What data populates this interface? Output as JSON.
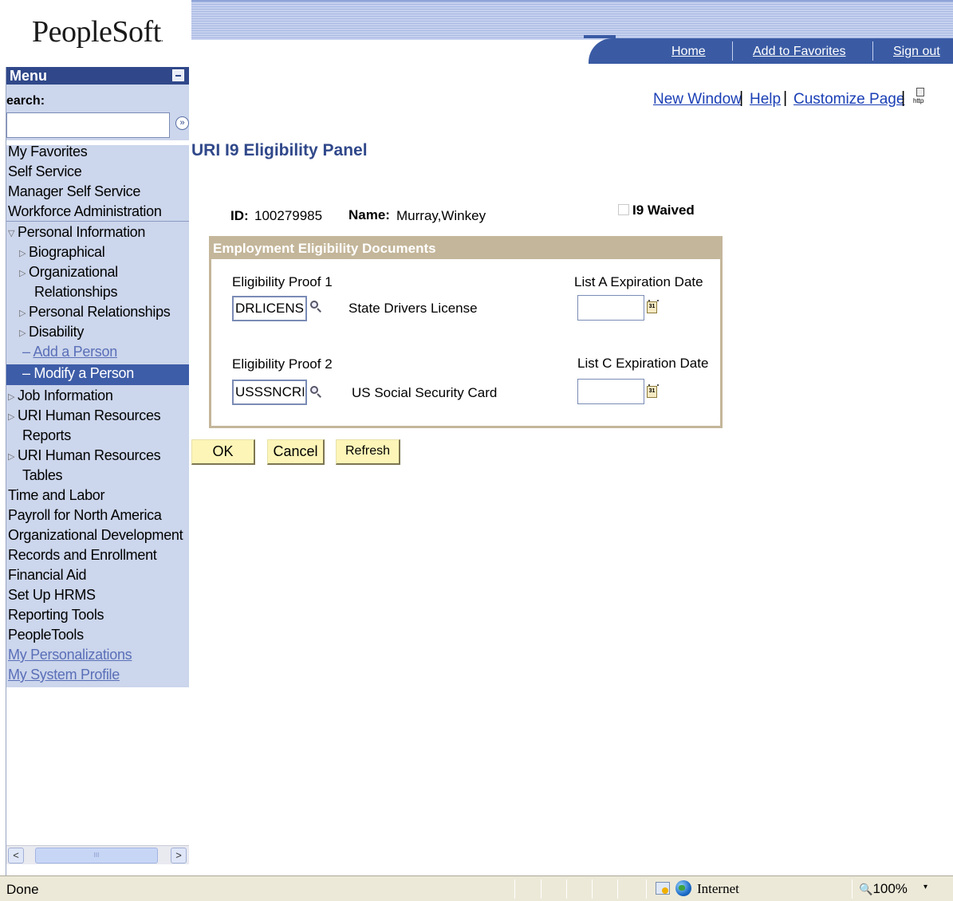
{
  "brand": {
    "logo_text": "PeopleSoft",
    "logo_mark": "."
  },
  "top_nav": {
    "home": "Home",
    "add_to_favorites": "Add to Favorites",
    "sign_out": "Sign out"
  },
  "utility_links": {
    "new_window": "New Window",
    "help": "Help",
    "customize_page": "Customize Page",
    "separator": "|",
    "http_icon_text": "http"
  },
  "menu": {
    "title": "Menu",
    "search_label": "earch:",
    "search_value": "",
    "search_go": "»",
    "items": [
      {
        "label": "My Favorites"
      },
      {
        "label": "Self Service"
      },
      {
        "label": "Manager Self Service"
      },
      {
        "label": "Workforce Administration"
      },
      {
        "label": "Personal Information",
        "marker": "▽"
      },
      {
        "label": "Biographical",
        "marker": "▷"
      },
      {
        "label": "Organizational",
        "marker": "▷"
      },
      {
        "label": "Relationships"
      },
      {
        "label": "Personal Relationships",
        "marker": "▷"
      },
      {
        "label": "Disability",
        "marker": "▷"
      },
      {
        "label": "Add a Person",
        "marker": "–"
      },
      {
        "label": "Modify a Person",
        "marker": "–"
      },
      {
        "label": "Job Information",
        "marker": "▷"
      },
      {
        "label": "URI Human Resources",
        "marker": "▷"
      },
      {
        "label": "Reports"
      },
      {
        "label": "URI Human Resources",
        "marker": "▷"
      },
      {
        "label": "Tables"
      },
      {
        "label": "Time and Labor"
      },
      {
        "label": "Payroll for North America"
      },
      {
        "label": "Organizational Development"
      },
      {
        "label": "Records and Enrollment"
      },
      {
        "label": "Financial Aid"
      },
      {
        "label": "Set Up HRMS"
      },
      {
        "label": "Reporting Tools"
      },
      {
        "label": "PeopleTools"
      },
      {
        "label": "My Personalizations"
      },
      {
        "label": "My System Profile"
      }
    ]
  },
  "scrollbar": {
    "left_arrow": "<",
    "right_arrow": ">",
    "thumb_grip": "III"
  },
  "page": {
    "title": "URI I9 Eligibility Panel",
    "id_label": "ID:",
    "id_value": "100279985",
    "name_label": "Name:",
    "name_value": "Murray,Winkey",
    "i9_waived_label": "I9 Waived",
    "i9_waived_checked": false,
    "group_title": "Employment Eligibility Documents",
    "proof1": {
      "label": "Eligibility Proof 1",
      "code": "DRLICENSI",
      "description": "State Drivers License",
      "exp_label": "List A Expiration Date",
      "exp_value": ""
    },
    "proof2": {
      "label": "Eligibility Proof 2",
      "code": "USSSNCRI",
      "description": "US Social Security Card",
      "exp_label": "List C Expiration Date",
      "exp_value": ""
    },
    "calendar_icon_text": "31",
    "buttons": {
      "ok": "OK",
      "cancel": "Cancel",
      "refresh": "Refresh"
    }
  },
  "status_bar": {
    "status": "Done",
    "zone": "Internet",
    "zoom": "100%",
    "zoom_icon": "🔍",
    "zoom_menu": "▾"
  }
}
